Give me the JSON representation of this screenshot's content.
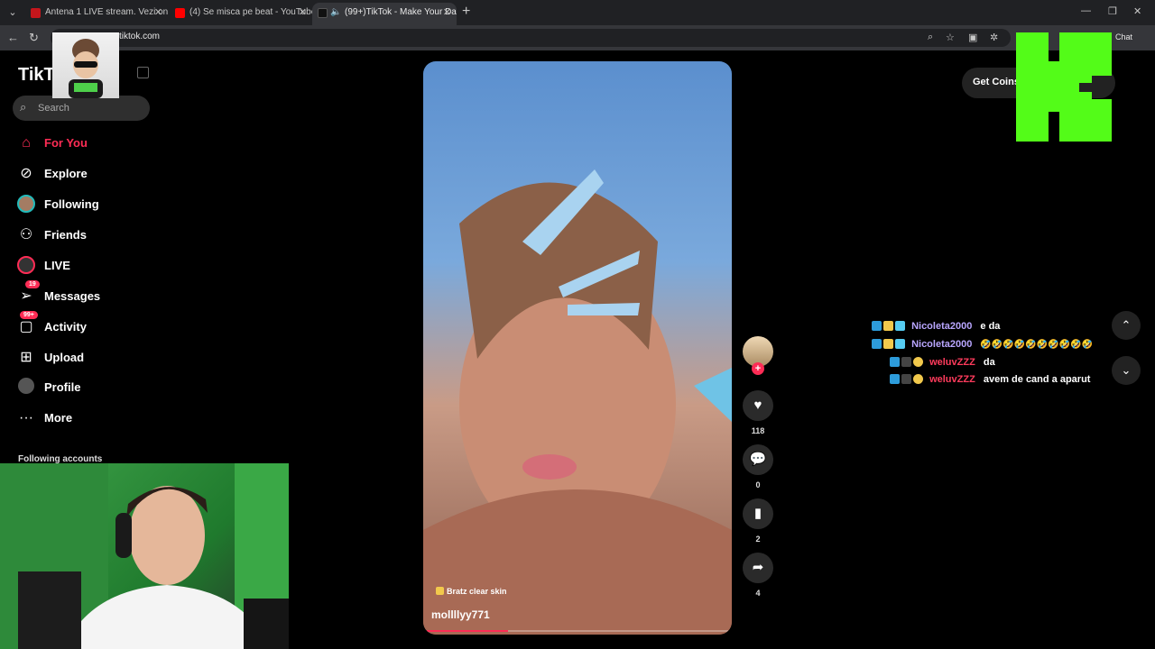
{
  "browser": {
    "tabs": [
      {
        "title": "Antena 1 LIVE stream. Vezi online"
      },
      {
        "title": "(4) Se misca pe beat - YouTube"
      },
      {
        "title": "(99+)TikTok - Make Your Day"
      }
    ],
    "url": "tiktok.com",
    "chat_label": "Chat",
    "colors": {
      "tab_bar": "#202124",
      "toolbar": "#35363a"
    }
  },
  "sidebar": {
    "logo": "TikTok",
    "search_placeholder": "Search",
    "items": [
      {
        "label": "For You",
        "icon": "home-icon"
      },
      {
        "label": "Explore",
        "icon": "compass-icon"
      },
      {
        "label": "Following",
        "icon": "following-avatar-icon"
      },
      {
        "label": "Friends",
        "icon": "friends-icon"
      },
      {
        "label": "LIVE",
        "icon": "live-icon"
      },
      {
        "label": "Messages",
        "icon": "messages-icon",
        "badge": "19"
      },
      {
        "label": "Activity",
        "icon": "activity-icon",
        "badge": "99+"
      },
      {
        "label": "Upload",
        "icon": "upload-icon"
      },
      {
        "label": "Profile",
        "icon": "profile-icon"
      },
      {
        "label": "More",
        "icon": "more-icon"
      }
    ],
    "following_accounts_label": "Following accounts",
    "accent": "#fe2c55"
  },
  "video": {
    "tag": "Bratz clear skin",
    "author": "mollllyy771",
    "progress": 0.27
  },
  "actions": {
    "likes": "118",
    "comments": "0",
    "saves": "2",
    "shares": "4"
  },
  "get_coins": "Get Coins",
  "chat": [
    {
      "user": "Nicoleta2000",
      "message": "e da",
      "user_color": "#b9a6ff"
    },
    {
      "user": "Nicoleta2000",
      "message": "🤣🤣🤣🤣🤣🤣🤣🤣🤣🤣",
      "user_color": "#b9a6ff"
    },
    {
      "user": "weluvZZZ",
      "message": "da",
      "user_color": "#ff3b5c"
    },
    {
      "user": "weluvZZZ",
      "message": "avem de cand a aparut",
      "user_color": "#ff3b5c"
    }
  ]
}
